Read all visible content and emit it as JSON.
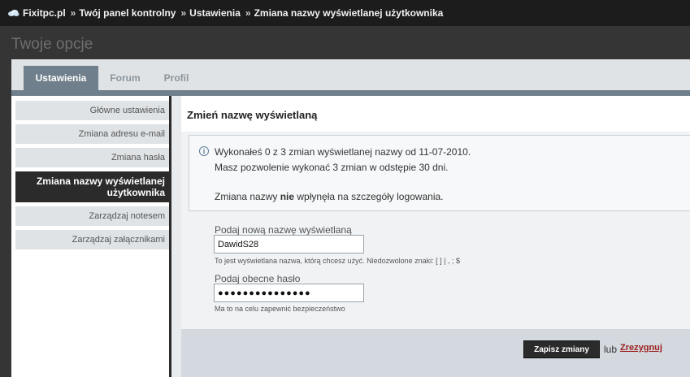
{
  "breadcrumb": {
    "items": [
      "Fixitpc.pl",
      "Twój panel kontrolny",
      "Ustawienia",
      "Zmiana nazwy wyświetlanej użytkownika"
    ],
    "separator": "»"
  },
  "page": {
    "title": "Twoje opcje"
  },
  "tabs": [
    {
      "label": "Ustawienia",
      "active": true
    },
    {
      "label": "Forum",
      "active": false
    },
    {
      "label": "Profil",
      "active": false
    }
  ],
  "sidebar": {
    "items": [
      {
        "label": "Główne ustawienia"
      },
      {
        "label": "Zmiana adresu e-mail"
      },
      {
        "label": "Zmiana hasła"
      },
      {
        "label": "Zmiana nazwy wyświetlanej użytkownika",
        "active": true
      },
      {
        "label": "Zarządzaj notesem"
      },
      {
        "label": "Zarządzaj załącznikami"
      }
    ]
  },
  "content": {
    "title": "Zmień nazwę wyświetlaną",
    "notice": {
      "line1": "Wykonałeś 0 z 3 zmian wyświetlanej nazwy od 11-07-2010.",
      "line2": "Masz pozwolenie wykonać 3 zmian w odstępie 30 dni.",
      "line3_pre": "Zmiana nazwy ",
      "line3_bold": "nie",
      "line3_post": " wpłynęła na szczegóły logowania."
    },
    "displayname": {
      "label": "Podaj nową nazwę wyświetlaną",
      "value": "DawidS28",
      "hint": "To jest wyświetlana nazwa, którą chcesz użyć. Niedozwolone znaki: [ ] | , ; $"
    },
    "password": {
      "label": "Podaj obecne hasło",
      "value": "●●●●●●●●●●●●●●●",
      "hint": "Ma to na celu zapewnić bezpieczeństwo"
    },
    "footer": {
      "save_label": "Zapisz zmiany",
      "or_label": "lub",
      "cancel_label": "Zrezygnuj"
    }
  }
}
